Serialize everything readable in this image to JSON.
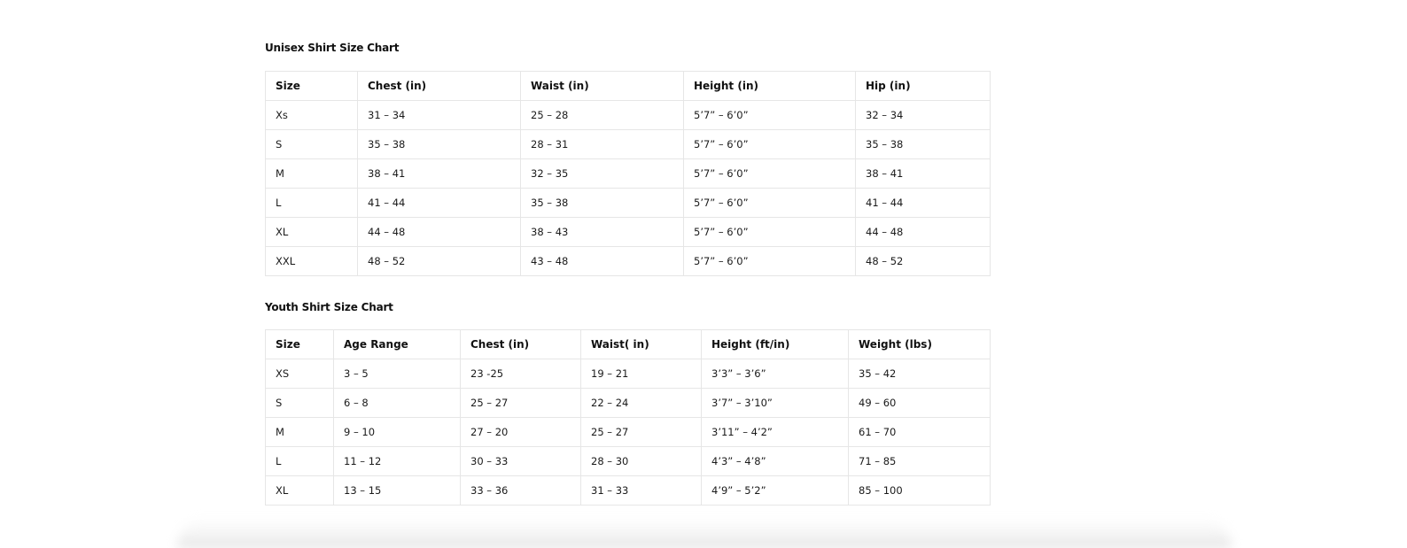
{
  "unisex": {
    "title": "Unisex Shirt Size Chart",
    "headers": [
      "Size",
      "Chest (in)",
      "Waist (in)",
      "Height (in)",
      "Hip (in)"
    ],
    "rows": [
      [
        "Xs",
        "31 – 34",
        "25 – 28",
        "5’7” – 6’0”",
        "32 – 34"
      ],
      [
        "S",
        "35 – 38",
        "28 – 31",
        "5’7” – 6’0”",
        "35 – 38"
      ],
      [
        "M",
        "38 – 41",
        "32 – 35",
        "5’7” – 6’0”",
        "38 – 41"
      ],
      [
        "L",
        "41 – 44",
        "35 – 38",
        "5’7” – 6’0”",
        "41 – 44"
      ],
      [
        "XL",
        "44 – 48",
        "38 – 43",
        "5’7” – 6’0”",
        "44 – 48"
      ],
      [
        "XXL",
        "48 – 52",
        "43 – 48",
        "5’7” – 6’0”",
        "48 – 52"
      ]
    ]
  },
  "youth": {
    "title": "Youth Shirt Size Chart",
    "headers": [
      "Size",
      "Age Range",
      "Chest (in)",
      "Waist( in)",
      "Height (ft/in)",
      "Weight (lbs)"
    ],
    "rows": [
      [
        "XS",
        "3 – 5",
        "23 -25",
        "19 – 21",
        "3’3” – 3’6”",
        "35 – 42"
      ],
      [
        "S",
        "6 – 8",
        "25 – 27",
        "22 – 24",
        "3’7” – 3’10”",
        "49 – 60"
      ],
      [
        "M",
        "9 – 10",
        "27 – 20",
        "25 – 27",
        "3’11” – 4’2”",
        "61 – 70"
      ],
      [
        "L",
        "11 – 12",
        "30 – 33",
        "28 – 30",
        "4’3” – 4’8”",
        "71 – 85"
      ],
      [
        "XL",
        "13 – 15",
        "33 – 36",
        "31 – 33",
        "4’9” – 5’2”",
        "85 – 100"
      ]
    ]
  }
}
